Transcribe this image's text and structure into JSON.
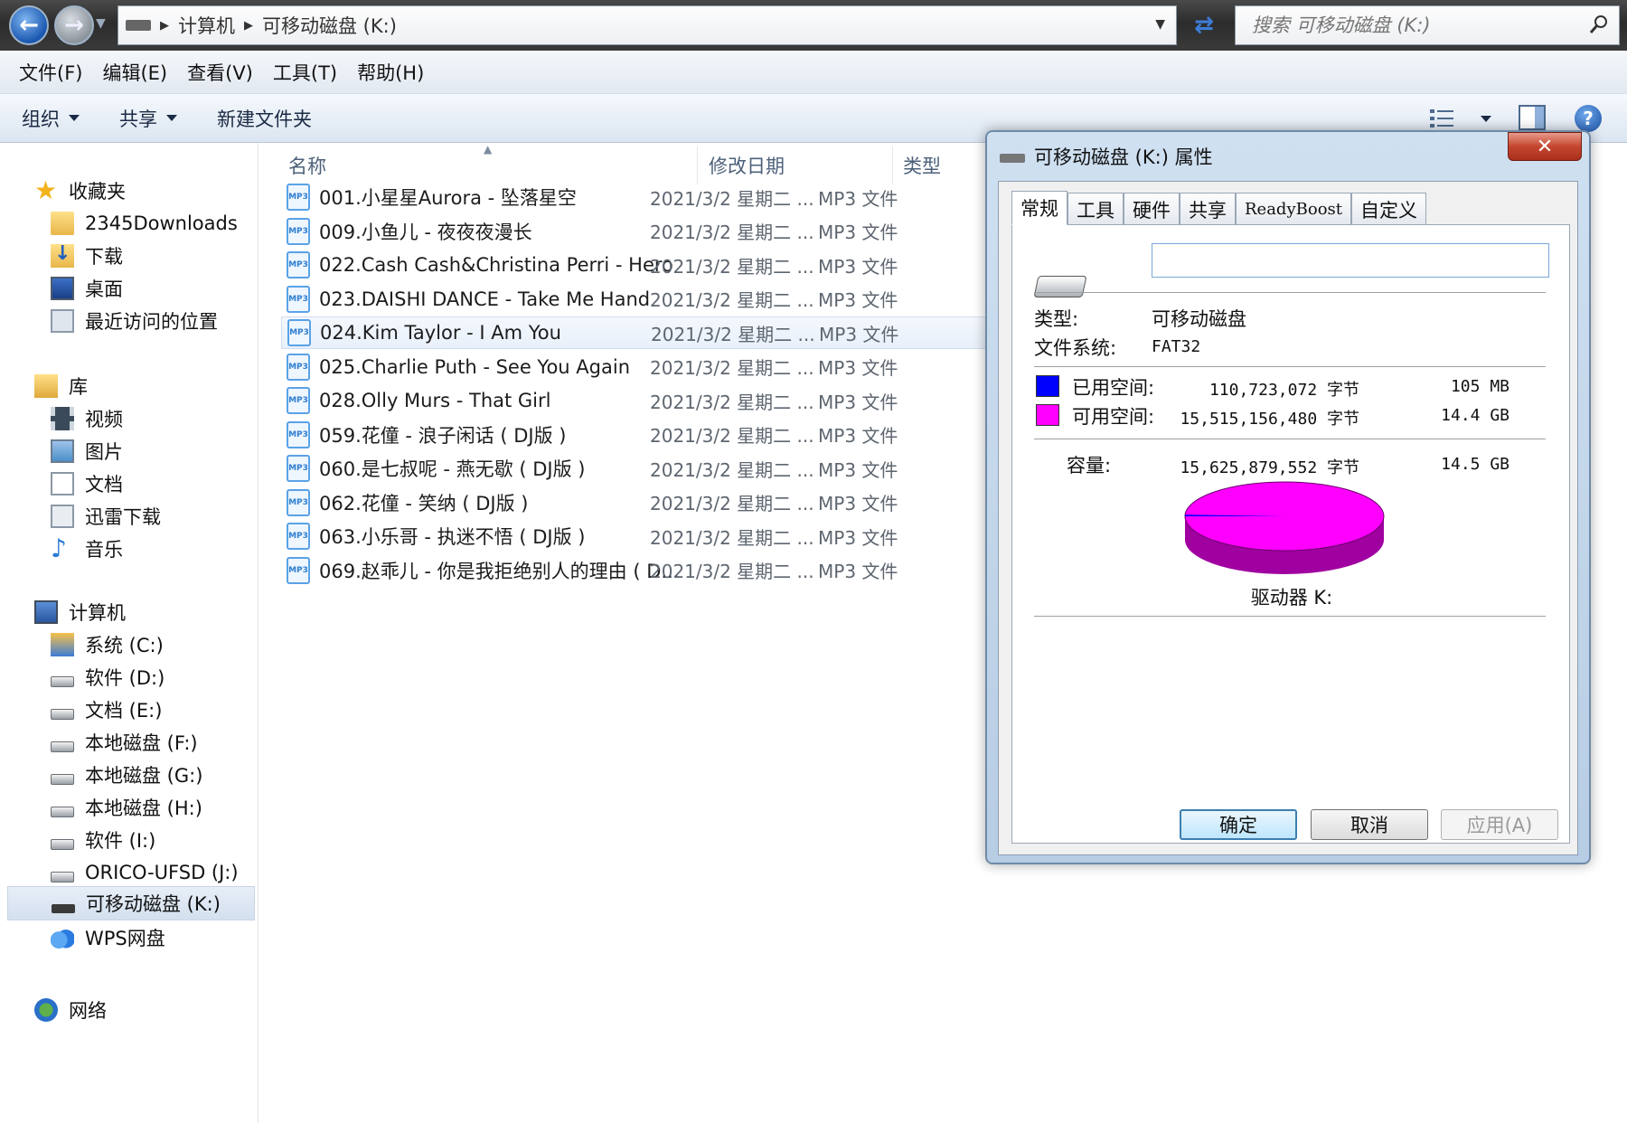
{
  "address": {
    "crumbs": [
      "计算机",
      "可移动磁盘 (K:)"
    ],
    "search_placeholder": "搜索 可移动磁盘 (K:)"
  },
  "menu": [
    "文件(F)",
    "编辑(E)",
    "查看(V)",
    "工具(T)",
    "帮助(H)"
  ],
  "toolbar": {
    "organize": "组织",
    "share": "共享",
    "new_folder": "新建文件夹"
  },
  "sidebar": {
    "favorites": {
      "label": "收藏夹",
      "items": [
        "2345Downloads",
        "下载",
        "桌面",
        "最近访问的位置"
      ]
    },
    "libraries": {
      "label": "库",
      "items": [
        "视频",
        "图片",
        "文档",
        "迅雷下载",
        "音乐"
      ]
    },
    "computer": {
      "label": "计算机",
      "items": [
        "系统 (C:)",
        "软件 (D:)",
        "文档 (E:)",
        "本地磁盘 (F:)",
        "本地磁盘 (G:)",
        "本地磁盘 (H:)",
        "软件 (I:)",
        "ORICO-UFSD (J:)",
        "可移动磁盘 (K:)",
        "WPS网盘"
      ]
    },
    "network": {
      "label": "网络"
    }
  },
  "columns": {
    "name": "名称",
    "date": "修改日期",
    "type": "类型"
  },
  "files": [
    {
      "name": "001.小星星Aurora - 坠落星空",
      "date": "2021/3/2 星期二 ...",
      "type": "MP3 文件"
    },
    {
      "name": "009.小鱼儿 - 夜夜夜漫长",
      "date": "2021/3/2 星期二 ...",
      "type": "MP3 文件"
    },
    {
      "name": "022.Cash Cash&Christina Perri - Hero",
      "date": "2021/3/2 星期二 ...",
      "type": "MP3 文件"
    },
    {
      "name": "023.DAISHI DANCE - Take Me Hand",
      "date": "2021/3/2 星期二 ...",
      "type": "MP3 文件"
    },
    {
      "name": "024.Kim Taylor - I Am You",
      "date": "2021/3/2 星期二 ...",
      "type": "MP3 文件"
    },
    {
      "name": "025.Charlie Puth - See You Again",
      "date": "2021/3/2 星期二 ...",
      "type": "MP3 文件"
    },
    {
      "name": "028.Olly Murs - That Girl",
      "date": "2021/3/2 星期二 ...",
      "type": "MP3 文件"
    },
    {
      "name": "059.花僮 - 浪子闲话 ( DJ版 )",
      "date": "2021/3/2 星期二 ...",
      "type": "MP3 文件"
    },
    {
      "name": "060.是七叔呢 - 燕无歇 ( DJ版 )",
      "date": "2021/3/2 星期二 ...",
      "type": "MP3 文件"
    },
    {
      "name": "062.花僮 - 笑纳 ( DJ版 )",
      "date": "2021/3/2 星期二 ...",
      "type": "MP3 文件"
    },
    {
      "name": "063.小乐哥 - 执迷不悟 ( DJ版 )",
      "date": "2021/3/2 星期二 ...",
      "type": "MP3 文件"
    },
    {
      "name": "069.赵乖儿 - 你是我拒绝别人的理由 ( D...",
      "date": "2021/3/2 星期二 ...",
      "type": "MP3 文件"
    }
  ],
  "dialog": {
    "title": "可移动磁盘 (K:) 属性",
    "tabs": [
      "常规",
      "工具",
      "硬件",
      "共享",
      "ReadyBoost",
      "自定义"
    ],
    "type_label": "类型:",
    "type_value": "可移动磁盘",
    "fs_label": "文件系统:",
    "fs_value": "FAT32",
    "used_label": "已用空间:",
    "used_bytes": "110,723,072 字节",
    "used_size": "105 MB",
    "free_label": "可用空间:",
    "free_bytes": "15,515,156,480 字节",
    "free_size": "14.4 GB",
    "capacity_label": "容量:",
    "capacity_bytes": "15,625,879,552 字节",
    "capacity_size": "14.5 GB",
    "drive_caption": "驱动器 K:",
    "ok": "确定",
    "cancel": "取消",
    "apply": "应用(A)",
    "colors": {
      "used": "#0000ff",
      "free": "#ff00ff"
    },
    "used_fraction": 0.0071
  }
}
